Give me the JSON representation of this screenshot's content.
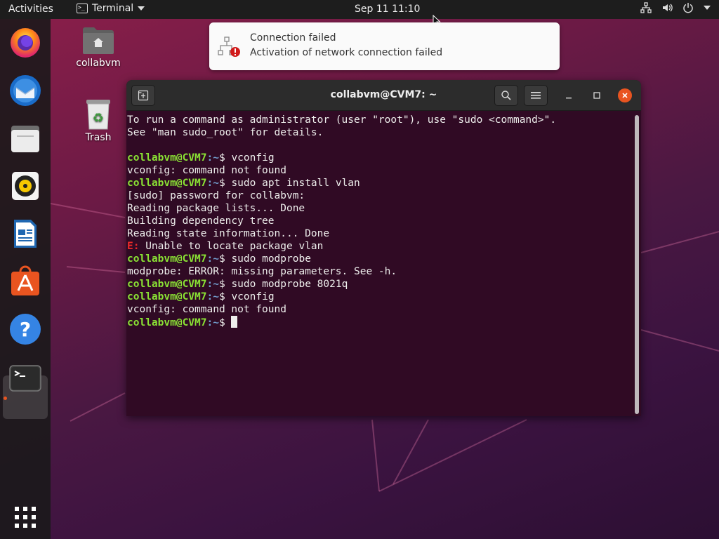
{
  "topbar": {
    "activities": "Activities",
    "app_name": "Terminal",
    "clock": "Sep 11  11:10",
    "tray_icons": [
      "network-wired-icon",
      "volume-icon",
      "power-icon",
      "chevron-down-icon"
    ]
  },
  "dock": {
    "items": [
      {
        "name": "Firefox",
        "icon": "firefox-icon"
      },
      {
        "name": "Thunderbird",
        "icon": "thunderbird-icon"
      },
      {
        "name": "Files",
        "icon": "files-icon"
      },
      {
        "name": "Rhythmbox",
        "icon": "rhythmbox-icon"
      },
      {
        "name": "LibreOffice Writer",
        "icon": "writer-icon"
      },
      {
        "name": "Ubuntu Software",
        "icon": "software-icon"
      },
      {
        "name": "Help",
        "icon": "help-icon"
      },
      {
        "name": "Terminal",
        "icon": "terminal-icon",
        "active": true
      }
    ],
    "apps_grid_icon": "apps-grid-icon"
  },
  "desktop": {
    "home_label": "collabvm",
    "trash_label": "Trash"
  },
  "notification": {
    "title": "Connection failed",
    "body": "Activation of network connection failed",
    "icon": "network-error-icon"
  },
  "terminal": {
    "title": "collabvm@CVM7: ~",
    "prompt_user": "collabvm@CVM7",
    "prompt_path": ":~",
    "prompt_sym": "$ ",
    "lines": [
      {
        "kind": "text",
        "text": "To run a command as administrator (user \"root\"), use \"sudo <command>\"."
      },
      {
        "kind": "text",
        "text": "See \"man sudo_root\" for details."
      },
      {
        "kind": "text",
        "text": ""
      },
      {
        "kind": "prompt",
        "text": "vconfig"
      },
      {
        "kind": "text",
        "text": "vconfig: command not found"
      },
      {
        "kind": "prompt",
        "text": "sudo apt install vlan"
      },
      {
        "kind": "text",
        "text": "[sudo] password for collabvm:"
      },
      {
        "kind": "text",
        "text": "Reading package lists... Done"
      },
      {
        "kind": "text",
        "text": "Building dependency tree"
      },
      {
        "kind": "text",
        "text": "Reading state information... Done"
      },
      {
        "kind": "error",
        "prefix": "E:",
        "text": " Unable to locate package vlan"
      },
      {
        "kind": "prompt",
        "text": "sudo modprobe"
      },
      {
        "kind": "text",
        "text": "modprobe: ERROR: missing parameters. See -h."
      },
      {
        "kind": "prompt",
        "text": "sudo modprobe 8021q"
      },
      {
        "kind": "prompt",
        "text": "vconfig"
      },
      {
        "kind": "text",
        "text": "vconfig: command not found"
      },
      {
        "kind": "cursor",
        "text": ""
      }
    ]
  },
  "colors": {
    "accent": "#e95420",
    "terminal_bg": "#300a24",
    "prompt_user": "#8ae234",
    "prompt_path": "#729fcf",
    "error": "#ef2929"
  }
}
